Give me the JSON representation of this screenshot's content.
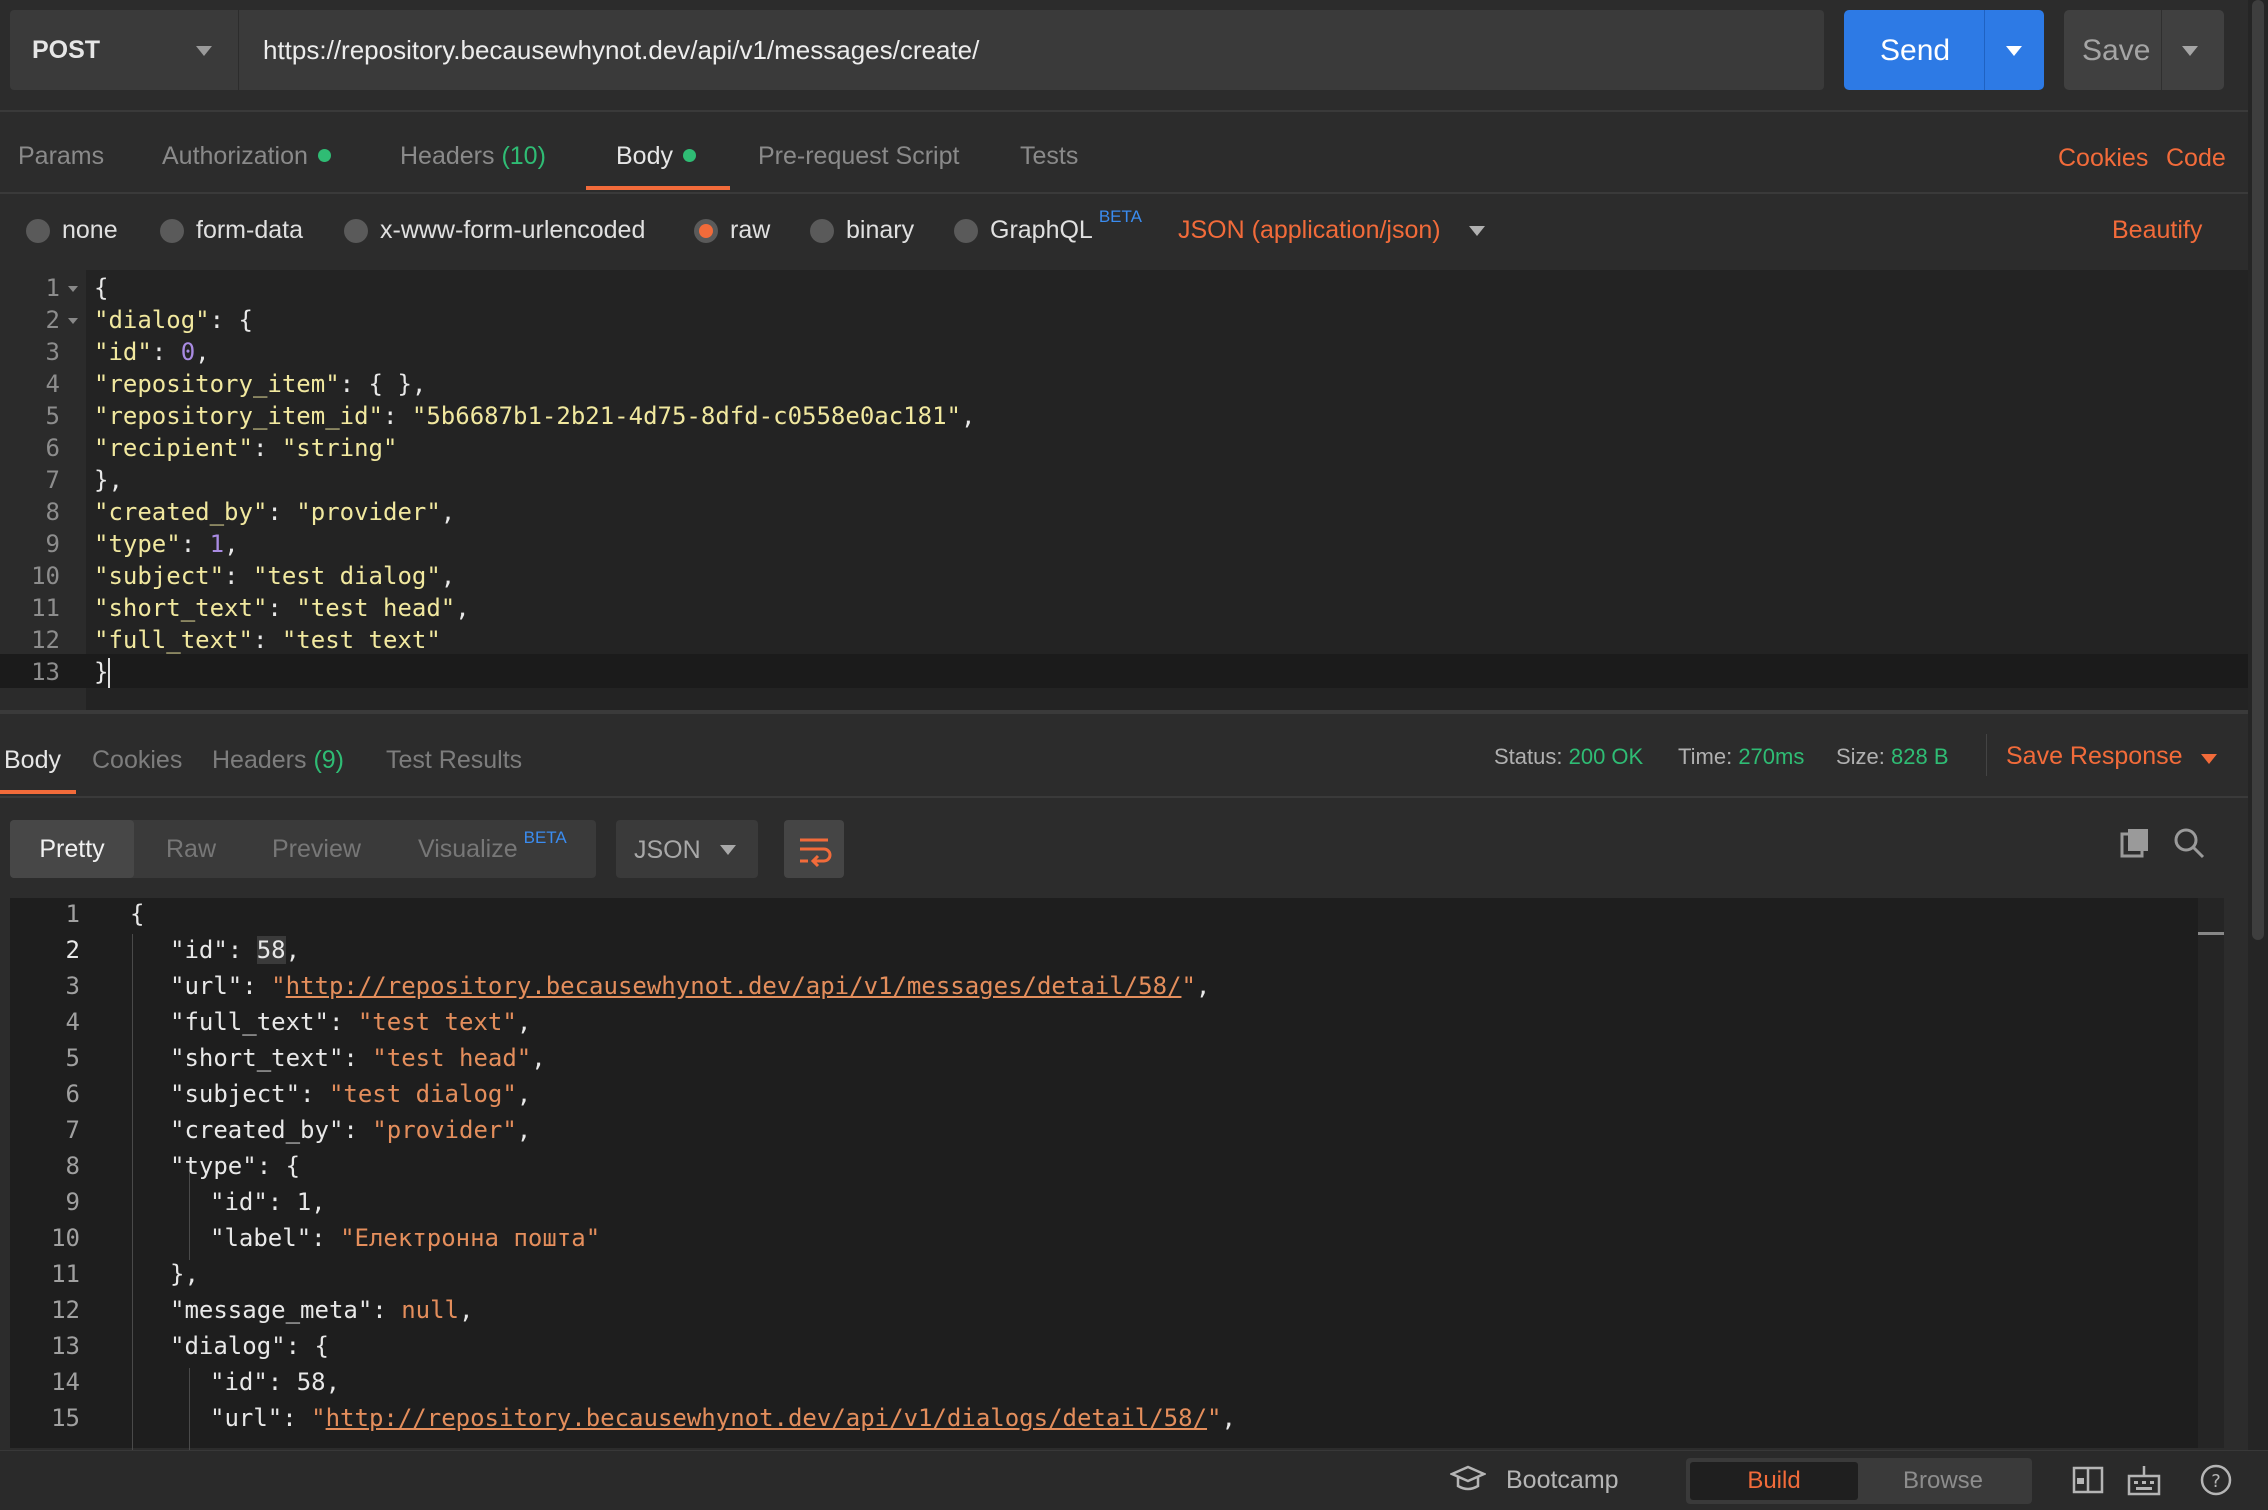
{
  "request": {
    "method": "POST",
    "url": "https://repository.becausewhynot.dev/api/v1/messages/create/",
    "send_label": "Send",
    "save_label": "Save"
  },
  "req_tabs": {
    "params": "Params",
    "authorization": "Authorization",
    "headers": "Headers",
    "headers_count": "(10)",
    "body": "Body",
    "prerequest": "Pre-request Script",
    "tests": "Tests",
    "cookies": "Cookies",
    "code": "Code"
  },
  "body_types": {
    "none": "none",
    "form_data": "form-data",
    "urlencoded": "x-www-form-urlencoded",
    "raw": "raw",
    "binary": "binary",
    "graphql": "GraphQL",
    "beta": "BETA",
    "content_type": "JSON (application/json)",
    "beautify": "Beautify",
    "selected": "raw"
  },
  "request_body": {
    "line_numbers": [
      "1",
      "2",
      "3",
      "4",
      "5",
      "6",
      "7",
      "8",
      "9",
      "10",
      "11",
      "12",
      "13"
    ],
    "lines": [
      [
        {
          "t": "{",
          "c": "p"
        }
      ],
      [
        {
          "t": "\"dialog\"",
          "c": "k"
        },
        {
          "t": ": {",
          "c": "p"
        }
      ],
      [
        {
          "t": "\"id\"",
          "c": "k"
        },
        {
          "t": ": ",
          "c": "p"
        },
        {
          "t": "0",
          "c": "n"
        },
        {
          "t": ",",
          "c": "p"
        }
      ],
      [
        {
          "t": "\"repository_item\"",
          "c": "k"
        },
        {
          "t": ": { },",
          "c": "p"
        }
      ],
      [
        {
          "t": "\"repository_item_id\"",
          "c": "k"
        },
        {
          "t": ": ",
          "c": "p"
        },
        {
          "t": "\"5b6687b1-2b21-4d75-8dfd-c0558e0ac181\"",
          "c": "s"
        },
        {
          "t": ",",
          "c": "p"
        }
      ],
      [
        {
          "t": "\"recipient\"",
          "c": "k"
        },
        {
          "t": ": ",
          "c": "p"
        },
        {
          "t": "\"string\"",
          "c": "s"
        }
      ],
      [
        {
          "t": "},",
          "c": "p"
        }
      ],
      [
        {
          "t": "\"created_by\"",
          "c": "k"
        },
        {
          "t": ": ",
          "c": "p"
        },
        {
          "t": "\"provider\"",
          "c": "s"
        },
        {
          "t": ",",
          "c": "p"
        }
      ],
      [
        {
          "t": "\"type\"",
          "c": "k"
        },
        {
          "t": ": ",
          "c": "p"
        },
        {
          "t": "1",
          "c": "n"
        },
        {
          "t": ",",
          "c": "p"
        }
      ],
      [
        {
          "t": "\"subject\"",
          "c": "k"
        },
        {
          "t": ": ",
          "c": "p"
        },
        {
          "t": "\"test dialog\"",
          "c": "s"
        },
        {
          "t": ",",
          "c": "p"
        }
      ],
      [
        {
          "t": "\"short_text\"",
          "c": "k"
        },
        {
          "t": ": ",
          "c": "p"
        },
        {
          "t": "\"test head\"",
          "c": "s"
        },
        {
          "t": ",",
          "c": "p"
        }
      ],
      [
        {
          "t": "\"full_text\"",
          "c": "k"
        },
        {
          "t": ": ",
          "c": "p"
        },
        {
          "t": "\"test text\"",
          "c": "s"
        }
      ],
      [
        {
          "t": "}",
          "c": "p"
        }
      ]
    ]
  },
  "resp_tabs": {
    "body": "Body",
    "cookies": "Cookies",
    "headers": "Headers",
    "headers_count": "(9)",
    "test_results": "Test Results"
  },
  "status": {
    "status_label": "Status:",
    "status_value": "200 OK",
    "time_label": "Time:",
    "time_value": "270ms",
    "size_label": "Size:",
    "size_value": "828 B",
    "save_response": "Save Response"
  },
  "view_modes": {
    "pretty": "Pretty",
    "raw": "Raw",
    "preview": "Preview",
    "visualize": "Visualize",
    "beta": "BETA",
    "format": "JSON"
  },
  "response_body": {
    "line_numbers": [
      "1",
      "2",
      "3",
      "4",
      "5",
      "6",
      "7",
      "8",
      "9",
      "10",
      "11",
      "12",
      "13",
      "14",
      "15"
    ],
    "lines": [
      {
        "indent": 0,
        "parts": [
          {
            "t": "{",
            "c": "rp"
          }
        ]
      },
      {
        "indent": 1,
        "parts": [
          {
            "t": "\"id\"",
            "c": "rk"
          },
          {
            "t": ": ",
            "c": "rp"
          },
          {
            "t": "58",
            "c": "rn hl"
          },
          {
            "t": ",",
            "c": "rp"
          }
        ]
      },
      {
        "indent": 1,
        "parts": [
          {
            "t": "\"url\"",
            "c": "rk"
          },
          {
            "t": ": ",
            "c": "rp"
          },
          {
            "t": "\"",
            "c": "rs"
          },
          {
            "t": "http://repository.becausewhynot.dev/api/v1/messages/detail/58/",
            "c": "rl"
          },
          {
            "t": "\"",
            "c": "rs"
          },
          {
            "t": ",",
            "c": "rp"
          }
        ]
      },
      {
        "indent": 1,
        "parts": [
          {
            "t": "\"full_text\"",
            "c": "rk"
          },
          {
            "t": ": ",
            "c": "rp"
          },
          {
            "t": "\"test text\"",
            "c": "rs"
          },
          {
            "t": ",",
            "c": "rp"
          }
        ]
      },
      {
        "indent": 1,
        "parts": [
          {
            "t": "\"short_text\"",
            "c": "rk"
          },
          {
            "t": ": ",
            "c": "rp"
          },
          {
            "t": "\"test head\"",
            "c": "rs"
          },
          {
            "t": ",",
            "c": "rp"
          }
        ]
      },
      {
        "indent": 1,
        "parts": [
          {
            "t": "\"subject\"",
            "c": "rk"
          },
          {
            "t": ": ",
            "c": "rp"
          },
          {
            "t": "\"test dialog\"",
            "c": "rs"
          },
          {
            "t": ",",
            "c": "rp"
          }
        ]
      },
      {
        "indent": 1,
        "parts": [
          {
            "t": "\"created_by\"",
            "c": "rk"
          },
          {
            "t": ": ",
            "c": "rp"
          },
          {
            "t": "\"provider\"",
            "c": "rs"
          },
          {
            "t": ",",
            "c": "rp"
          }
        ]
      },
      {
        "indent": 1,
        "parts": [
          {
            "t": "\"type\"",
            "c": "rk"
          },
          {
            "t": ": {",
            "c": "rp"
          }
        ]
      },
      {
        "indent": 2,
        "parts": [
          {
            "t": "\"id\"",
            "c": "rk"
          },
          {
            "t": ": ",
            "c": "rp"
          },
          {
            "t": "1",
            "c": "rn"
          },
          {
            "t": ",",
            "c": "rp"
          }
        ]
      },
      {
        "indent": 2,
        "parts": [
          {
            "t": "\"label\"",
            "c": "rk"
          },
          {
            "t": ": ",
            "c": "rp"
          },
          {
            "t": "\"Електронна пошта\"",
            "c": "rs"
          }
        ]
      },
      {
        "indent": 1,
        "parts": [
          {
            "t": "},",
            "c": "rp"
          }
        ]
      },
      {
        "indent": 1,
        "parts": [
          {
            "t": "\"message_meta\"",
            "c": "rk"
          },
          {
            "t": ": ",
            "c": "rp"
          },
          {
            "t": "null",
            "c": "rnull"
          },
          {
            "t": ",",
            "c": "rp"
          }
        ]
      },
      {
        "indent": 1,
        "parts": [
          {
            "t": "\"dialog\"",
            "c": "rk"
          },
          {
            "t": ": {",
            "c": "rp"
          }
        ]
      },
      {
        "indent": 2,
        "parts": [
          {
            "t": "\"id\"",
            "c": "rk"
          },
          {
            "t": ": ",
            "c": "rp"
          },
          {
            "t": "58",
            "c": "rn"
          },
          {
            "t": ",",
            "c": "rp"
          }
        ]
      },
      {
        "indent": 2,
        "parts": [
          {
            "t": "\"url\"",
            "c": "rk"
          },
          {
            "t": ": ",
            "c": "rp"
          },
          {
            "t": "\"",
            "c": "rs"
          },
          {
            "t": "http://repository.becausewhynot.dev/api/v1/dialogs/detail/58/",
            "c": "rl"
          },
          {
            "t": "\"",
            "c": "rs"
          },
          {
            "t": ",",
            "c": "rp"
          }
        ]
      }
    ]
  },
  "footer": {
    "bootcamp": "Bootcamp",
    "build": "Build",
    "browse": "Browse"
  },
  "colors": {
    "accent": "#f26b3a",
    "send": "#2d7ae5",
    "success": "#2fbc74"
  }
}
